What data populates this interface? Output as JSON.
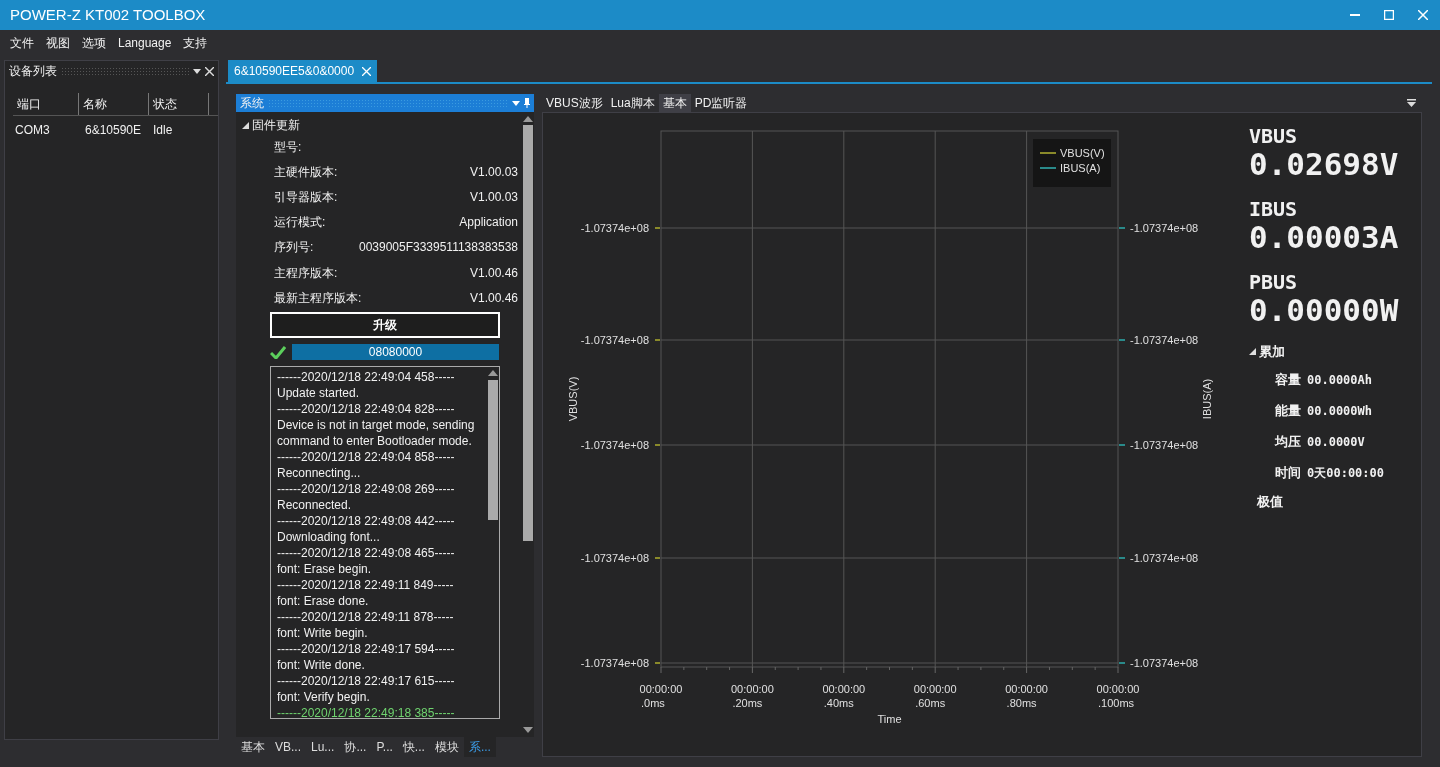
{
  "window": {
    "title": "POWER-Z KT002 TOOLBOX"
  },
  "menu": [
    "文件",
    "视图",
    "选项",
    "Language",
    "支持"
  ],
  "device_panel": {
    "title": "设备列表",
    "columns": [
      "端口",
      "名称",
      "状态"
    ],
    "rows": [
      {
        "cells": [
          "COM3",
          "6&10590E",
          "Idle"
        ]
      }
    ]
  },
  "document_tabs": [
    {
      "label": "6&10590EE5&0&0000",
      "selected": true
    }
  ],
  "system_panel": {
    "title": "系统",
    "firmware": {
      "title": "固件更新",
      "expanded": true,
      "fields": [
        {
          "label": "型号:"
        },
        {
          "label": "主硬件版本:",
          "value": "V1.00.03"
        },
        {
          "label": "引导器版本:",
          "value": "V1.00.03"
        },
        {
          "label": "运行模式:",
          "value": "Application"
        },
        {
          "label": "序列号:",
          "value": "0039005F3339511138383538"
        },
        {
          "label": "主程序版本:",
          "value": "V1.00.46"
        },
        {
          "label": "最新主程序版本:",
          "value": "V1.00.46"
        }
      ],
      "upgrade_button": "升级",
      "progress": {
        "text": "08080000",
        "level": 1,
        "done": true
      }
    },
    "log": [
      {
        "text": "------2020/12/18 22:49:04 458-----",
        "highlighted": false
      },
      {
        "text": "Update started.",
        "highlighted": false
      },
      {
        "text": "------2020/12/18 22:49:04 828-----",
        "highlighted": false
      },
      {
        "text": "Device is not in target mode, sending",
        "highlighted": false
      },
      {
        "text": "command to enter Bootloader mode.",
        "highlighted": false
      },
      {
        "text": "------2020/12/18 22:49:04 858-----",
        "highlighted": false
      },
      {
        "text": "Reconnecting...",
        "highlighted": false
      },
      {
        "text": "------2020/12/18 22:49:08 269-----",
        "highlighted": false
      },
      {
        "text": "Reconnected.",
        "highlighted": false
      },
      {
        "text": "------2020/12/18 22:49:08 442-----",
        "highlighted": false
      },
      {
        "text": "Downloading font...",
        "highlighted": false
      },
      {
        "text": "------2020/12/18 22:49:08 465-----",
        "highlighted": false
      },
      {
        "text": "font: Erase begin.",
        "highlighted": false
      },
      {
        "text": "------2020/12/18 22:49:11 849-----",
        "highlighted": false
      },
      {
        "text": "font: Erase done.",
        "highlighted": false
      },
      {
        "text": "------2020/12/18 22:49:11 878-----",
        "highlighted": false
      },
      {
        "text": "font: Write begin.",
        "highlighted": false
      },
      {
        "text": "------2020/12/18 22:49:17 594-----",
        "highlighted": false
      },
      {
        "text": "font: Write done.",
        "highlighted": false
      },
      {
        "text": "------2020/12/18 22:49:17 615-----",
        "highlighted": false
      },
      {
        "text": "font: Verify begin.",
        "highlighted": false
      },
      {
        "text": "------2020/12/18 22:49:18 385-----",
        "highlighted": true
      }
    ],
    "bottom_tabs": [
      {
        "label": "基本",
        "selected": false
      },
      {
        "label": "VB...",
        "selected": false
      },
      {
        "label": "Lu...",
        "selected": false
      },
      {
        "label": "协...",
        "selected": false
      },
      {
        "label": "P...",
        "selected": false
      },
      {
        "label": "快...",
        "selected": false
      },
      {
        "label": "模块",
        "selected": false
      },
      {
        "label": "系...",
        "selected": true
      }
    ]
  },
  "view_tabs": [
    {
      "label": "VBUS波形",
      "selected": false
    },
    {
      "label": "Lua脚本",
      "selected": false
    },
    {
      "label": "基本",
      "selected": true
    },
    {
      "label": "PD监听器",
      "selected": false
    }
  ],
  "chart": {
    "legend": [
      {
        "name": "VBUS(V)",
        "color": "#8a8a2a"
      },
      {
        "name": "IBUS(A)",
        "color": "#2a8a8a"
      }
    ],
    "ylabel_left": "VBUS(V)",
    "ylabel_right": "IBUS(A)",
    "xlabel": "Time",
    "left_ticks": [
      "-1.07374e+08",
      "-1.07374e+08",
      "-1.07374e+08",
      "-1.07374e+08",
      "-1.07374e+08"
    ],
    "right_ticks": [
      "-1.07374e+08",
      "-1.07374e+08",
      "-1.07374e+08",
      "-1.07374e+08",
      "-1.07374e+08"
    ],
    "x_ticks": [
      [
        "00:00:00",
        ".0ms"
      ],
      [
        "00:00:00",
        ".20ms"
      ],
      [
        "00:00:00",
        ".40ms"
      ],
      [
        "00:00:00",
        ".60ms"
      ],
      [
        "00:00:00",
        ".80ms"
      ],
      [
        "00:00:00",
        ".100ms"
      ]
    ]
  },
  "readings": [
    {
      "label": "VBUS",
      "value": "0.02698V"
    },
    {
      "label": "IBUS",
      "value": "0.00003A"
    },
    {
      "label": "PBUS",
      "value": "0.00000W"
    }
  ],
  "accumulate": {
    "title": "累加",
    "expanded": true,
    "items": [
      {
        "label": "容量",
        "value": "00.0000Ah"
      },
      {
        "label": "能量",
        "value": "00.0000Wh"
      },
      {
        "label": "均压",
        "value": "00.0000V"
      },
      {
        "label": "时间",
        "value": "0天00:00:00"
      }
    ]
  },
  "extremes": {
    "title": "极值"
  }
}
